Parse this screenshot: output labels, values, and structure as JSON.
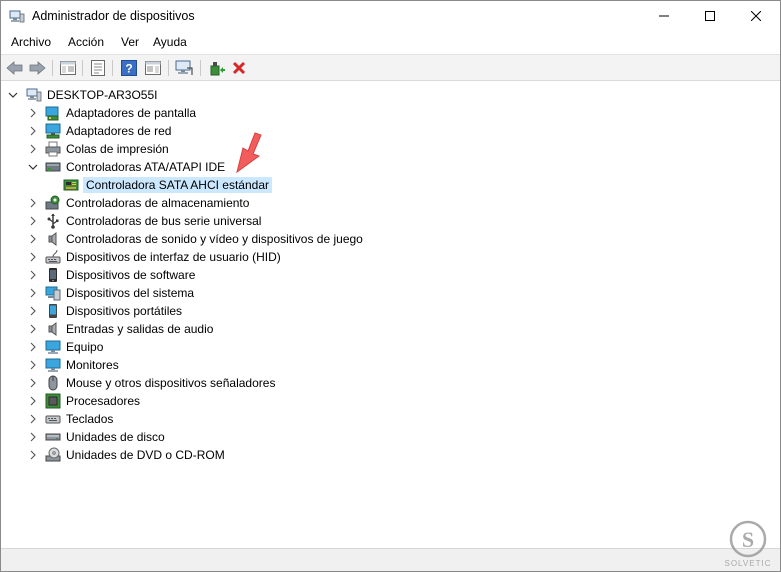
{
  "window": {
    "title": "Administrador de dispositivos"
  },
  "menu": [
    "Archivo",
    "Acción",
    "Ver",
    "Ayuda"
  ],
  "tree": {
    "root": "DESKTOP-AR3O55I",
    "items": [
      {
        "label": "Adaptadores de pantalla",
        "icon": "display-adapter-icon",
        "expanded": false
      },
      {
        "label": "Adaptadores de red",
        "icon": "network-adapter-icon",
        "expanded": false
      },
      {
        "label": "Colas de impresión",
        "icon": "print-queue-icon",
        "expanded": false
      },
      {
        "label": "Controladoras ATA/ATAPI IDE",
        "icon": "ide-controller-icon",
        "expanded": true,
        "children": [
          {
            "label": "Controladora SATA AHCI estándar",
            "icon": "ide-controller-icon",
            "selected": true
          }
        ]
      },
      {
        "label": "Controladoras de almacenamiento",
        "icon": "storage-controller-icon",
        "expanded": false
      },
      {
        "label": "Controladoras de bus serie universal",
        "icon": "usb-icon",
        "expanded": false
      },
      {
        "label": "Controladoras de sonido y vídeo y dispositivos de juego",
        "icon": "speaker-icon",
        "expanded": false
      },
      {
        "label": "Dispositivos de interfaz de usuario (HID)",
        "icon": "hid-icon",
        "expanded": false
      },
      {
        "label": "Dispositivos de software",
        "icon": "software-device-icon",
        "expanded": false
      },
      {
        "label": "Dispositivos del sistema",
        "icon": "system-device-icon",
        "expanded": false
      },
      {
        "label": "Dispositivos portátiles",
        "icon": "portable-device-icon",
        "expanded": false
      },
      {
        "label": "Entradas y salidas de audio",
        "icon": "speaker-icon",
        "expanded": false
      },
      {
        "label": "Equipo",
        "icon": "computer-icon",
        "expanded": false
      },
      {
        "label": "Monitores",
        "icon": "monitor-icon",
        "expanded": false
      },
      {
        "label": "Mouse y otros dispositivos señaladores",
        "icon": "mouse-icon",
        "expanded": false
      },
      {
        "label": "Procesadores",
        "icon": "processor-icon",
        "expanded": false
      },
      {
        "label": "Teclados",
        "icon": "keyboard-icon",
        "expanded": false
      },
      {
        "label": "Unidades de disco",
        "icon": "disk-drive-icon",
        "expanded": false
      },
      {
        "label": "Unidades de DVD o CD-ROM",
        "icon": "dvd-drive-icon",
        "expanded": false
      }
    ]
  },
  "toolbar": [
    "back-icon",
    "forward-icon",
    "show-hide-tree-icon",
    "properties-icon",
    "help-icon",
    "action-pane-icon",
    "scan-hardware-icon",
    "update-driver-icon",
    "uninstall-device-icon"
  ],
  "colors": {
    "selection": "#cce8ff",
    "accent_red": "#d62828",
    "annotation": "#f25c5c"
  },
  "watermark": "SOLVETIC"
}
